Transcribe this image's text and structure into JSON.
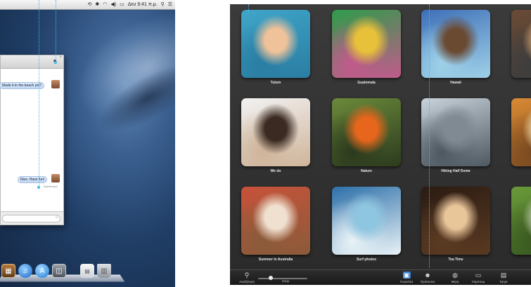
{
  "desktop": {
    "menubar": {
      "clock": "Δευ 9:41 π.μ."
    },
    "messages": {
      "bubbles": [
        {
          "text": "Made it to the beach yet?"
        },
        {
          "text": "Nice. Have fun!"
        }
      ],
      "read_receipt": "Διαβάστηκε"
    },
    "dock_icons": [
      "photo-stack-icon",
      "itunes-icon",
      "app-store-icon",
      "preview-icon",
      "documents-icon",
      "trash-icon"
    ]
  },
  "iphoto": {
    "events": [
      {
        "title": "Tulum",
        "palette": [
          "#3fa6c9",
          "#f0c29a",
          "#2a7da3"
        ]
      },
      {
        "title": "Guatemala",
        "palette": [
          "#2e9c4a",
          "#e8c13a",
          "#c25a8c"
        ]
      },
      {
        "title": "Hawaii",
        "palette": [
          "#3e6fb8",
          "#6b4a32",
          "#9ed1e8"
        ]
      },
      {
        "title": "",
        "palette": [
          "#6a4a35",
          "#c79a6c",
          "#3d3d3d"
        ]
      },
      {
        "title": "We do",
        "palette": [
          "#f2f2f2",
          "#3a2a22",
          "#cfb49a"
        ]
      },
      {
        "title": "Nature",
        "palette": [
          "#6b8a3a",
          "#e5661c",
          "#2c3b1e"
        ]
      },
      {
        "title": "Hiking Half Dome",
        "palette": [
          "#c9d3db",
          "#7f8a93",
          "#4e5860"
        ]
      },
      {
        "title": "",
        "palette": [
          "#d98a34",
          "#f0d3a0",
          "#7a4a20"
        ]
      },
      {
        "title": "Summer in Australia",
        "palette": [
          "#c8523a",
          "#f0e0cf",
          "#8a5b3a"
        ]
      },
      {
        "title": "Surf photos",
        "palette": [
          "#2c6fa8",
          "#8ec5e0",
          "#e8f2f7"
        ]
      },
      {
        "title": "Tea Time",
        "palette": [
          "#2b1b12",
          "#e9c59a",
          "#5a3a22"
        ]
      },
      {
        "title": "",
        "palette": [
          "#6a9a3a",
          "#b8c7a0",
          "#3a5a20"
        ]
      }
    ],
    "toolbar": {
      "search_label": "Αναζήτηση",
      "zoom_label": "Ζουμ",
      "zoom_value": 0.25,
      "tabs": [
        {
          "label": "Γεγονότα",
          "icon": "events-icon",
          "active": true
        },
        {
          "label": "Πρόσωπα",
          "icon": "faces-icon",
          "active": false
        },
        {
          "label": "Μέρη",
          "icon": "places-icon",
          "active": false
        },
        {
          "label": "Άλμπουμ",
          "icon": "albums-icon",
          "active": false
        },
        {
          "label": "Έργα",
          "icon": "projects-icon",
          "active": false
        }
      ]
    }
  }
}
